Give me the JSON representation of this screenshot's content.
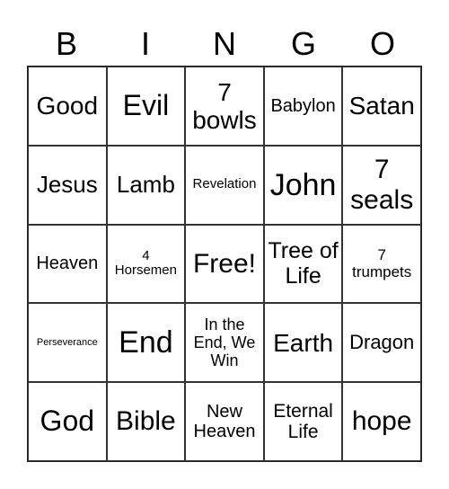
{
  "header": {
    "letters": [
      "B",
      "I",
      "N",
      "G",
      "O"
    ]
  },
  "cells": [
    [
      "Good",
      "Evil",
      "7 bowls",
      "Babylon",
      "Satan"
    ],
    [
      "Jesus",
      "Lamb",
      "Revelation",
      "John",
      "7 seals"
    ],
    [
      "Heaven",
      "4 Horsemen",
      "Free!",
      "Tree of Life",
      "7 trumpets"
    ],
    [
      "Perseverance",
      "End",
      "In the End, We Win",
      "Earth",
      "Dragon"
    ],
    [
      "God",
      "Bible",
      "New Heaven",
      "Eternal Life",
      "hope"
    ]
  ]
}
